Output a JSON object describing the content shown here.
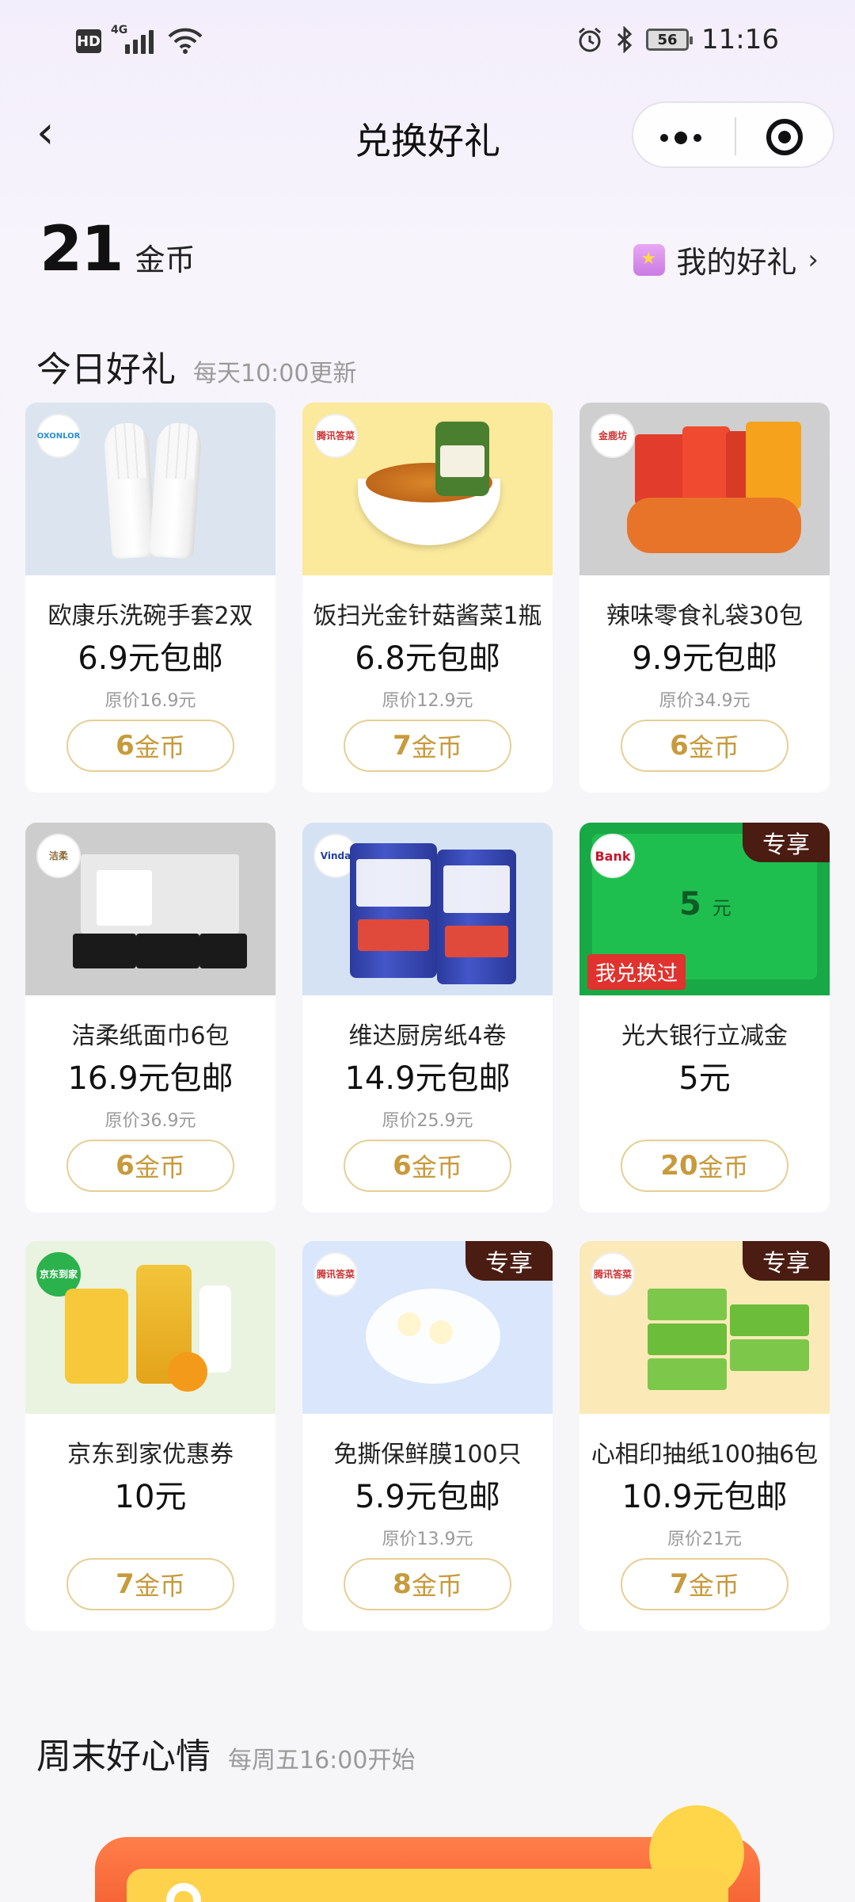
{
  "status_bar": {
    "time": "11:16",
    "battery": "56",
    "network": "4G",
    "hd": "HD"
  },
  "nav": {
    "title": "兑换好礼",
    "back_glyph": "‹"
  },
  "coins": {
    "value": "21",
    "unit": "金币"
  },
  "my_gifts": {
    "label": "我的好礼"
  },
  "today": {
    "title": "今日好礼",
    "subtitle": "每天10:00更新",
    "items": [
      {
        "name": "欧康乐洗碗手套2双",
        "price": "6.9元包邮",
        "original": "原价16.9元",
        "cost_num": "6",
        "cost_unit": "金币",
        "brand": "OXONLOR 欧康乐",
        "exclusive": "",
        "image_bg": "#dce5ef"
      },
      {
        "name": "饭扫光金针菇酱菜1瓶",
        "price": "6.8元包邮",
        "original": "原价12.9元",
        "cost_num": "7",
        "cost_unit": "金币",
        "brand": "腾讯答菜",
        "exclusive": "",
        "image_bg": "#fbe99c"
      },
      {
        "name": "辣味零食礼袋30包",
        "price": "9.9元包邮",
        "original": "原价34.9元",
        "cost_num": "6",
        "cost_unit": "金币",
        "brand": "金鹿坊",
        "exclusive": "",
        "image_bg": "#cfcfcf"
      },
      {
        "name": "洁柔纸面巾6包",
        "price": "16.9元包邮",
        "original": "原价36.9元",
        "cost_num": "6",
        "cost_unit": "金币",
        "brand": "洁柔",
        "exclusive": "",
        "image_bg": "#cdcdcd"
      },
      {
        "name": "维达厨房纸4卷",
        "price": "14.9元包邮",
        "original": "原价25.9元",
        "cost_num": "6",
        "cost_unit": "金币",
        "brand": "Vinda",
        "exclusive": "",
        "image_bg": "#d5e2f4"
      },
      {
        "name": "光大银行立减金",
        "price": "5元",
        "original": "",
        "cost_num": "20",
        "cost_unit": "金币",
        "brand": "Bank",
        "exclusive": "专享",
        "image_bg": "#18a845",
        "voucher_amount": "5",
        "voucher_unit": "元",
        "redeemed_label": "我兑换过"
      },
      {
        "name": "京东到家优惠券",
        "price": "10元",
        "original": "",
        "cost_num": "7",
        "cost_unit": "金币",
        "brand": "京东到家",
        "exclusive": "",
        "image_bg": "#eaf3e0"
      },
      {
        "name": "免撕保鲜膜100只",
        "price": "5.9元包邮",
        "original": "原价13.9元",
        "cost_num": "8",
        "cost_unit": "金币",
        "brand": "腾讯答菜",
        "exclusive": "专享",
        "image_bg": "#d9e6fb"
      },
      {
        "name": "心相印抽纸100抽6包",
        "price": "10.9元包邮",
        "original": "原价21元",
        "cost_num": "7",
        "cost_unit": "金币",
        "brand": "腾讯答菜",
        "exclusive": "专享",
        "image_bg": "#fbeab8"
      }
    ]
  },
  "weekend": {
    "title": "周末好心情",
    "subtitle": "每周五16:00开始"
  },
  "colors": {
    "accent_gold": "#c79a3c",
    "border_gold": "#e6cf96",
    "exclusive_bg": "#4a1c12",
    "redeemed_red": "#e0322e"
  }
}
